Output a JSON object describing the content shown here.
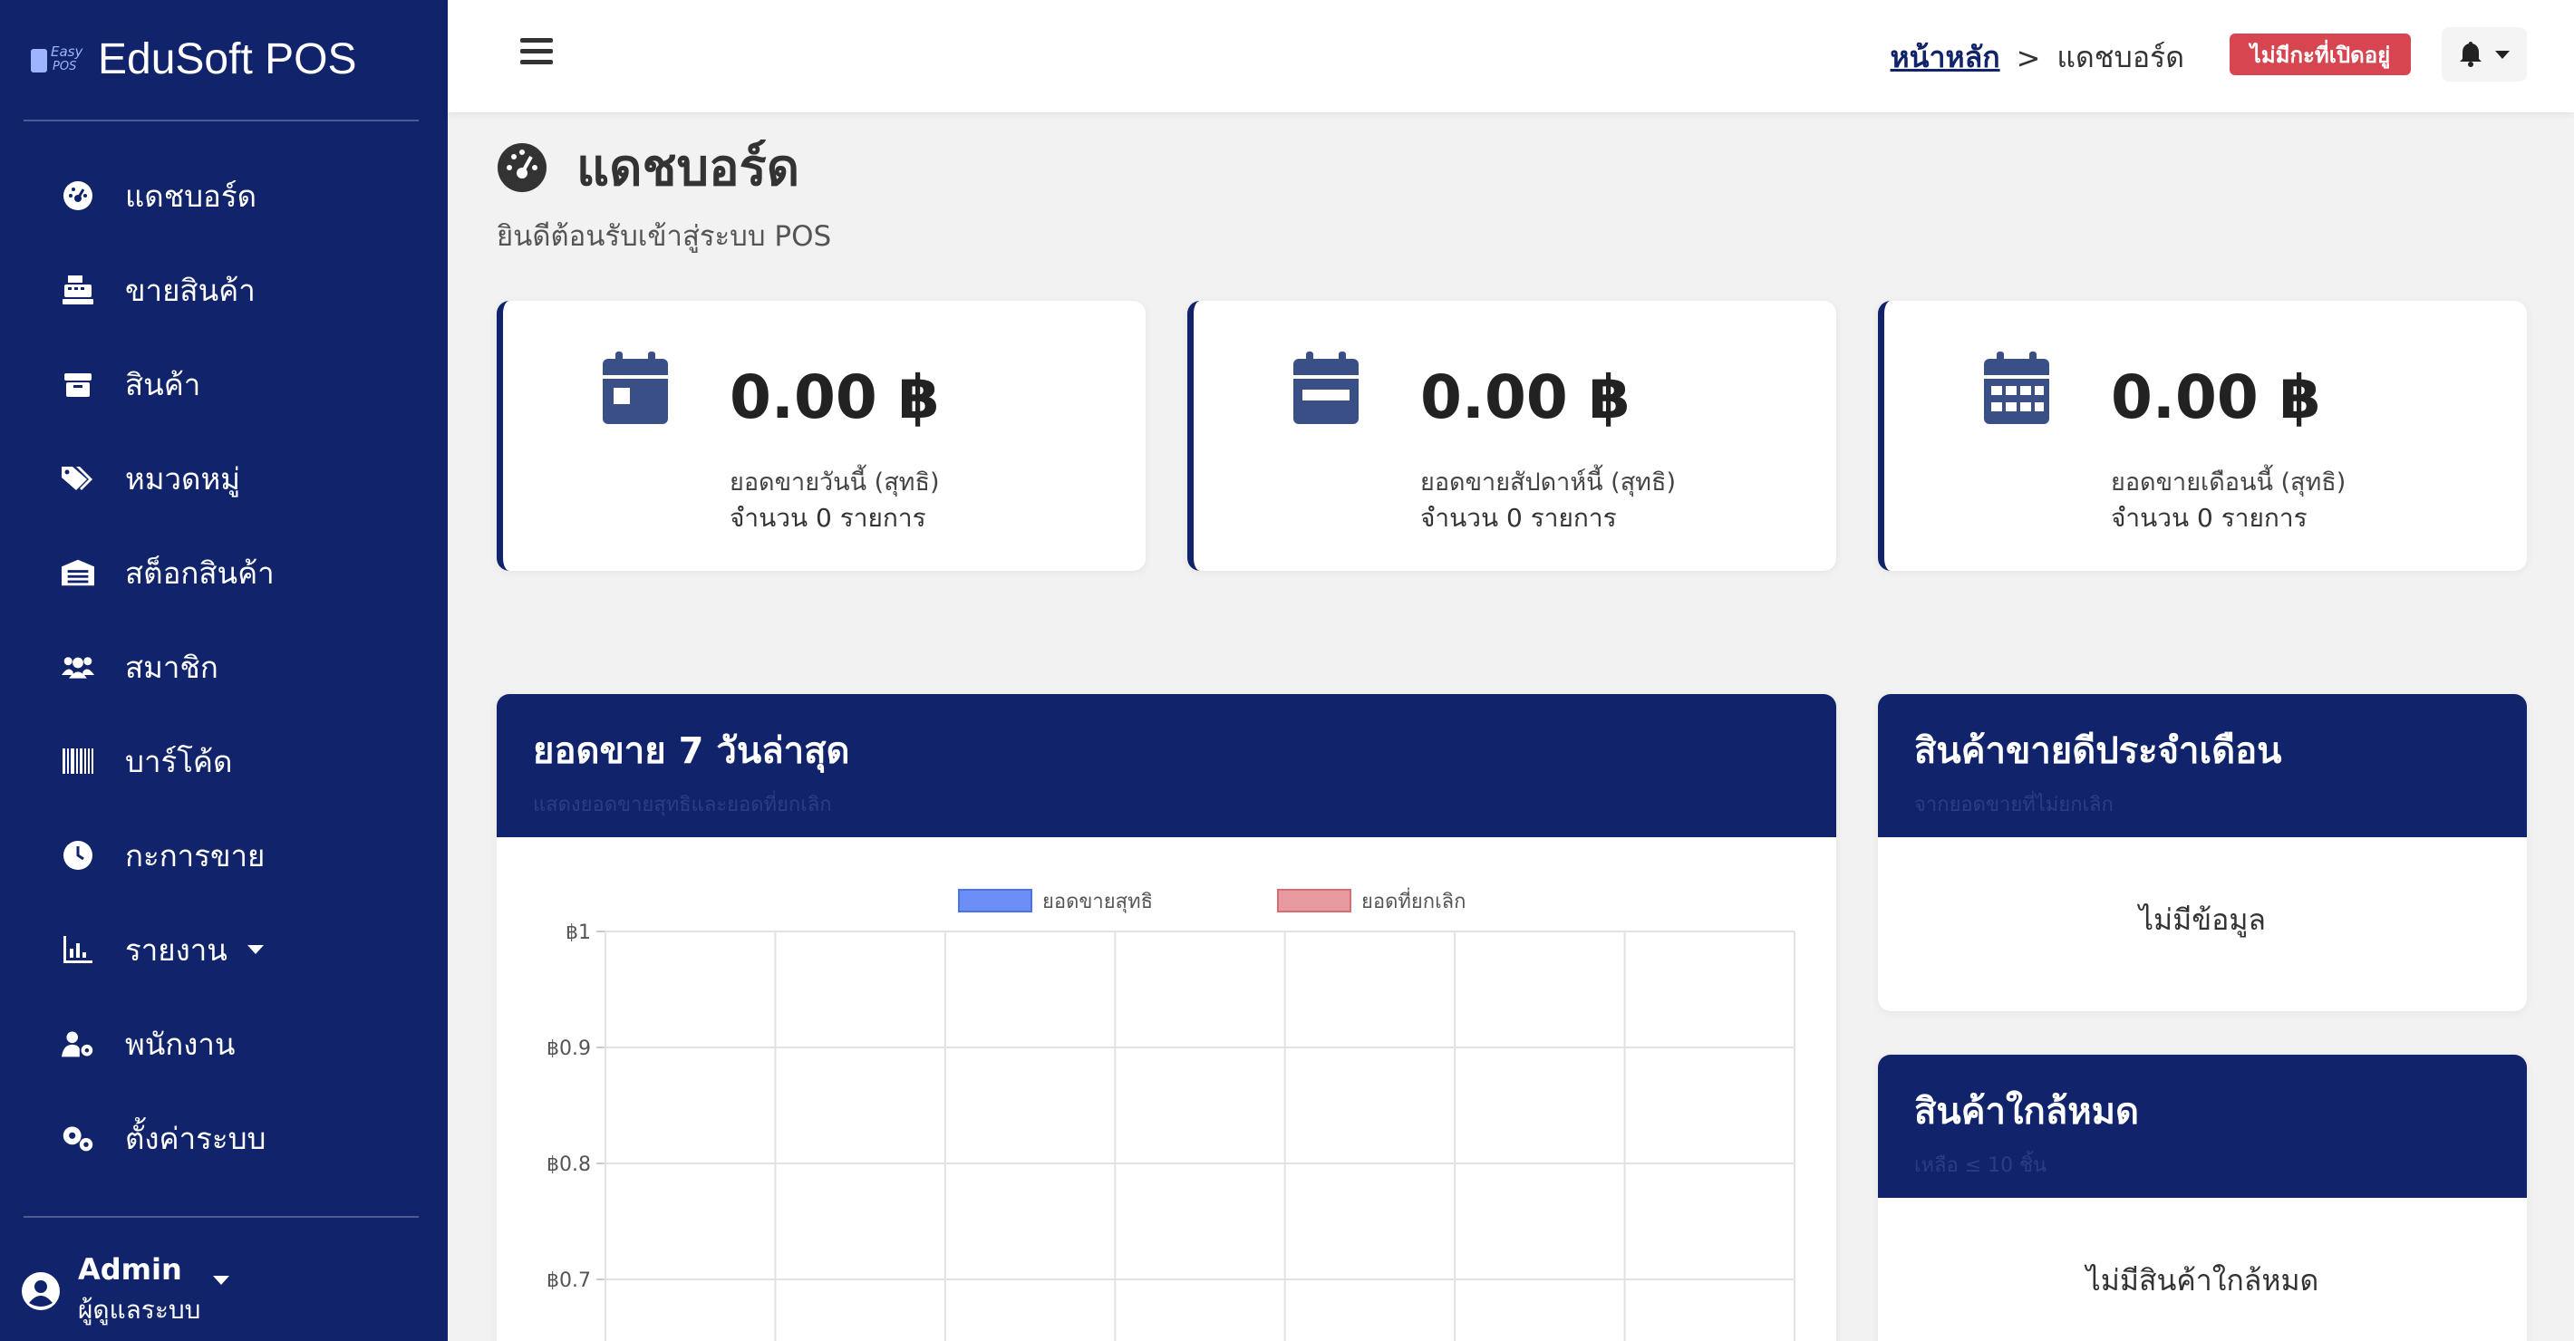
{
  "sidebar": {
    "brand": {
      "logo_top": "Easy",
      "logo_bottom": "POS",
      "name": "EduSoft POS"
    },
    "items": [
      {
        "label": "แดชบอร์ด",
        "icon": "dashboard-icon"
      },
      {
        "label": "ขายสินค้า",
        "icon": "cash-register-icon"
      },
      {
        "label": "สินค้า",
        "icon": "box-icon"
      },
      {
        "label": "หมวดหมู่",
        "icon": "tags-icon"
      },
      {
        "label": "สต็อกสินค้า",
        "icon": "warehouse-icon"
      },
      {
        "label": "สมาชิก",
        "icon": "users-icon"
      },
      {
        "label": "บาร์โค้ด",
        "icon": "barcode-icon"
      },
      {
        "label": "กะการขาย",
        "icon": "clock-icon"
      },
      {
        "label": "รายงาน",
        "icon": "chart-icon"
      },
      {
        "label": "พนักงาน",
        "icon": "user-gear-icon"
      },
      {
        "label": "ตั้งค่าระบบ",
        "icon": "gears-icon"
      }
    ],
    "user": {
      "name": "Admin",
      "role": "ผู้ดูแลระบบ"
    }
  },
  "topbar": {
    "breadcrumb_home": "หน้าหลัก",
    "breadcrumb_sep": ">",
    "breadcrumb_current": "แดชบอร์ด",
    "shift_badge": "ไม่มีกะที่เปิดอยู่"
  },
  "page": {
    "title": "แดชบอร์ด",
    "subtitle": "ยินดีต้อนรับเข้าสู่ระบบ POS"
  },
  "stats": [
    {
      "amount": "0.00 ฿",
      "label": "ยอดขายวันนี้ (สุทธิ)",
      "count": "จำนวน 0 รายการ",
      "icon": "calendar-day-icon"
    },
    {
      "amount": "0.00 ฿",
      "label": "ยอดขายสัปดาห์นี้ (สุทธิ)",
      "count": "จำนวน 0 รายการ",
      "icon": "calendar-week-icon"
    },
    {
      "amount": "0.00 ฿",
      "label": "ยอดขายเดือนนี้ (สุทธิ)",
      "count": "จำนวน 0 รายการ",
      "icon": "calendar-month-icon"
    }
  ],
  "sales_panel": {
    "title": "ยอดขาย 7 วันล่าสุด",
    "subtitle": "แสดงยอดขายสุทธิและยอดที่ยกเลิก"
  },
  "top_products": {
    "title": "สินค้าขายดีประจำเดือน",
    "subtitle": "จากยอดขายที่ไม่ยกเลิก",
    "empty": "ไม่มีข้อมูล"
  },
  "low_stock": {
    "title": "สินค้าใกล้หมด",
    "subtitle": "เหลือ ≤ 10 ชิ้น",
    "empty": "ไม่มีสินค้าใกล้หมด"
  },
  "colors": {
    "primary": "#11246b",
    "danger": "#d64550",
    "series_net": "#6b8ff7",
    "series_cancel": "#e79a9f"
  },
  "chart_data": {
    "type": "bar",
    "series": [
      {
        "name": "ยอดขายสุทธิ",
        "values": [
          0,
          0,
          0,
          0,
          0,
          0,
          0
        ]
      },
      {
        "name": "ยอดที่ยกเลิก",
        "values": [
          0,
          0,
          0,
          0,
          0,
          0,
          0
        ]
      }
    ],
    "yticks": [
      "฿1",
      "฿0.9",
      "฿0.8",
      "฿0.7"
    ],
    "ylim": [
      0,
      1
    ],
    "grid": true,
    "legend_position": "top"
  }
}
